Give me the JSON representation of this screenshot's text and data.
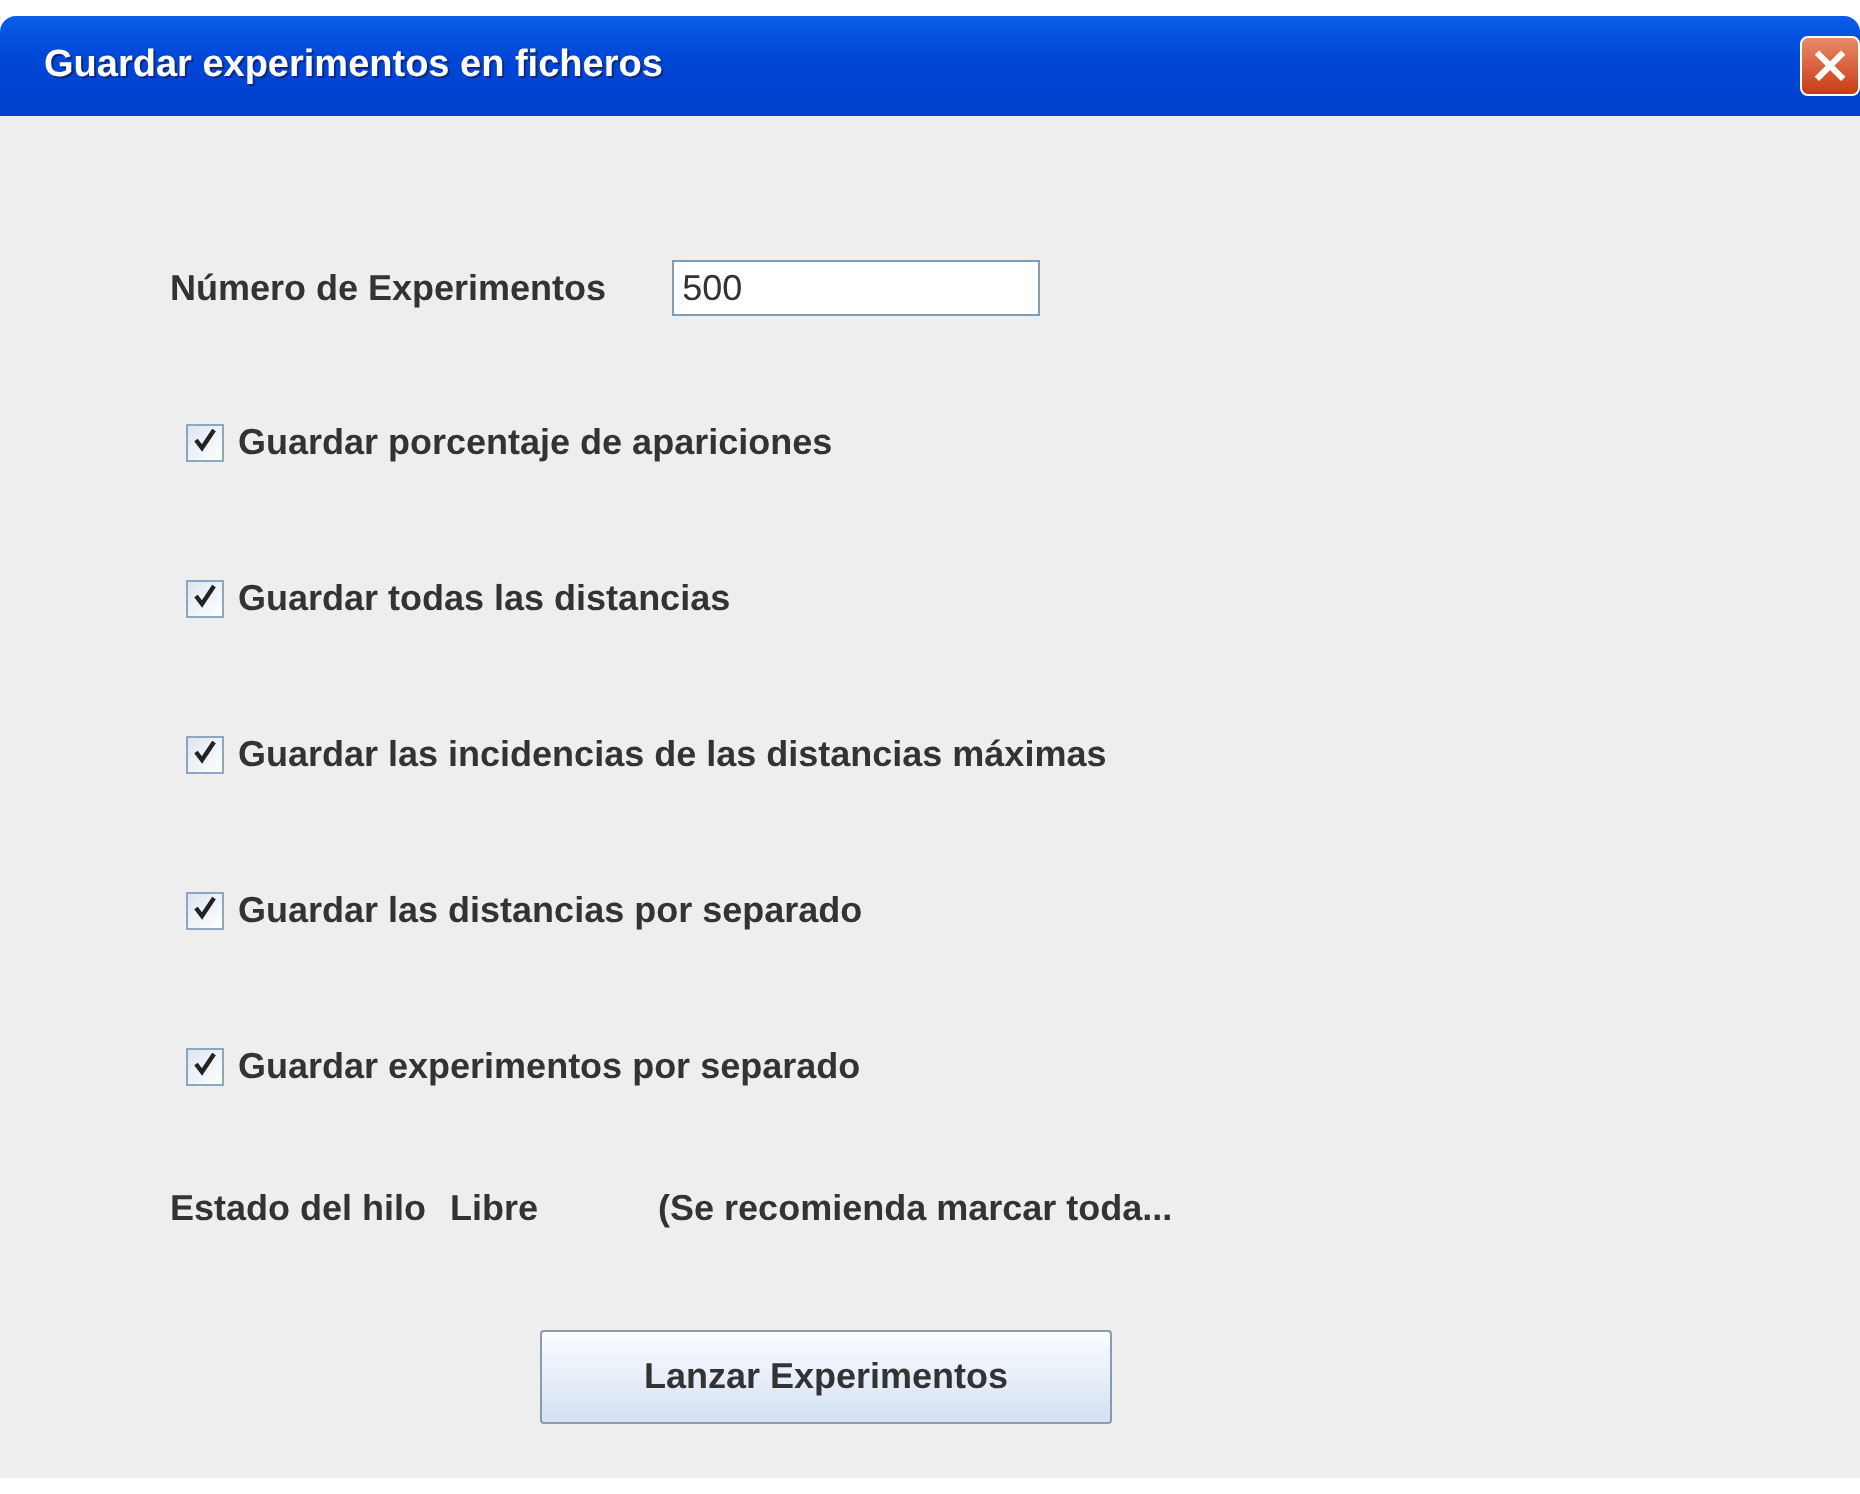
{
  "window": {
    "title": "Guardar experimentos en ficheros",
    "close": "×"
  },
  "experiments": {
    "label": "Número de Experimentos",
    "value": "500"
  },
  "options": [
    {
      "label": "Guardar porcentaje de apariciones",
      "checked": true
    },
    {
      "label": "Guardar todas las distancias",
      "checked": true
    },
    {
      "label": "Guardar las incidencias de las distancias máximas",
      "checked": true
    },
    {
      "label": "Guardar las distancias por separado",
      "checked": true
    },
    {
      "label": "Guardar experimentos por separado",
      "checked": true
    }
  ],
  "status": {
    "label": "Estado del hilo",
    "value": "Libre",
    "note": "(Se recomienda marcar toda..."
  },
  "buttons": [
    "Lanzar Experimentos"
  ]
}
